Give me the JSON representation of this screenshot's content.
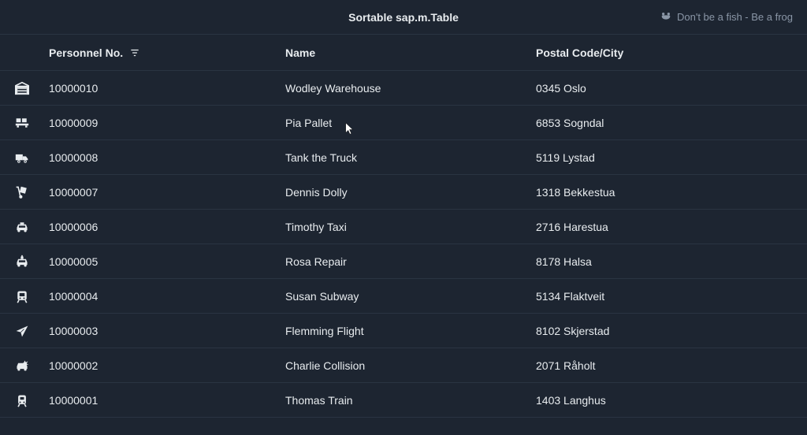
{
  "header": {
    "title": "Sortable sap.m.Table",
    "tagline": "Don't be a fish - Be a frog"
  },
  "columns": {
    "personnel": "Personnel No.",
    "name": "Name",
    "postal": "Postal Code/City"
  },
  "rows": [
    {
      "icon": "warehouse-icon",
      "personnel": "10000010",
      "name": "Wodley Warehouse",
      "postal": "0345 Oslo"
    },
    {
      "icon": "pallet-icon",
      "personnel": "10000009",
      "name": "Pia Pallet",
      "postal": "6853 Sogndal"
    },
    {
      "icon": "truck-icon",
      "personnel": "10000008",
      "name": "Tank the Truck",
      "postal": "5119 Lystad"
    },
    {
      "icon": "dolly-icon",
      "personnel": "10000007",
      "name": "Dennis Dolly",
      "postal": "1318 Bekkestua"
    },
    {
      "icon": "taxi-icon",
      "personnel": "10000006",
      "name": "Timothy Taxi",
      "postal": "2716 Harestua"
    },
    {
      "icon": "repair-icon",
      "personnel": "10000005",
      "name": "Rosa Repair",
      "postal": "8178 Halsa"
    },
    {
      "icon": "subway-icon",
      "personnel": "10000004",
      "name": "Susan Subway",
      "postal": "5134 Flaktveit"
    },
    {
      "icon": "flight-icon",
      "personnel": "10000003",
      "name": "Flemming Flight",
      "postal": "8102 Skjerstad"
    },
    {
      "icon": "collision-icon",
      "personnel": "10000002",
      "name": "Charlie Collision",
      "postal": "2071 Råholt"
    },
    {
      "icon": "train-icon",
      "personnel": "10000001",
      "name": "Thomas Train",
      "postal": "1403 Langhus"
    }
  ]
}
